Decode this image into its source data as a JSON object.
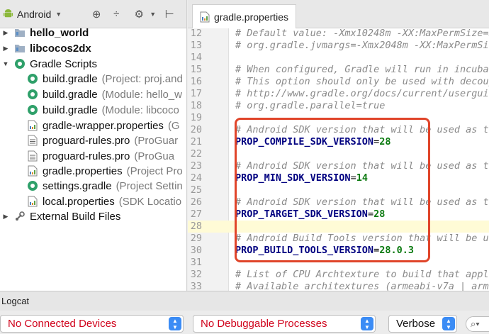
{
  "left_toolbar": {
    "view_label": "Android"
  },
  "tree": [
    {
      "label": "hello_world",
      "hint": "",
      "bold": true,
      "icon": "module-folder-icon",
      "arrow": "right"
    },
    {
      "label": "libcocos2dx",
      "hint": "",
      "bold": true,
      "icon": "module-folder-icon",
      "arrow": "right"
    },
    {
      "label": "Gradle Scripts",
      "hint": "",
      "bold": false,
      "icon": "gradle-icon",
      "arrow": "down"
    },
    {
      "label": "build.gradle",
      "hint": "(Project: proj.and",
      "bold": false,
      "icon": "gradle-icon",
      "arrow": ""
    },
    {
      "label": "build.gradle",
      "hint": "(Module: hello_w",
      "bold": false,
      "icon": "gradle-icon",
      "arrow": ""
    },
    {
      "label": "build.gradle",
      "hint": "(Module: libcoco",
      "bold": false,
      "icon": "gradle-icon",
      "arrow": ""
    },
    {
      "label": "gradle-wrapper.properties",
      "hint": "(G",
      "bold": false,
      "icon": "properties-file-icon",
      "arrow": ""
    },
    {
      "label": "proguard-rules.pro",
      "hint": "(ProGuar",
      "bold": false,
      "icon": "text-file-icon",
      "arrow": ""
    },
    {
      "label": "proguard-rules.pro",
      "hint": "(ProGua",
      "bold": false,
      "icon": "text-file-icon",
      "arrow": ""
    },
    {
      "label": "gradle.properties",
      "hint": "(Project Pro",
      "bold": false,
      "icon": "properties-file-icon",
      "arrow": ""
    },
    {
      "label": "settings.gradle",
      "hint": "(Project Settin",
      "bold": false,
      "icon": "gradle-icon",
      "arrow": ""
    },
    {
      "label": "local.properties",
      "hint": "(SDK Locatio",
      "bold": false,
      "icon": "properties-file-icon",
      "arrow": ""
    },
    {
      "label": "External Build Files",
      "hint": "",
      "bold": false,
      "icon": "external-build-icon",
      "arrow": "right"
    }
  ],
  "editor": {
    "tab_label": "gradle.properties",
    "lines": [
      {
        "n": "12",
        "parts": [
          {
            "t": "# Default value: -Xmx10248m -XX:MaxPermSize=2",
            "c": "comment"
          }
        ]
      },
      {
        "n": "13",
        "parts": [
          {
            "t": "# org.gradle.jvmargs=-Xmx2048m -XX:MaxPermSiz",
            "c": "comment"
          }
        ]
      },
      {
        "n": "14",
        "parts": []
      },
      {
        "n": "15",
        "parts": [
          {
            "t": "# When configured, Gradle will run in incubat",
            "c": "comment"
          }
        ]
      },
      {
        "n": "16",
        "parts": [
          {
            "t": "# This option should only be used with decoup",
            "c": "comment"
          }
        ]
      },
      {
        "n": "17",
        "parts": [
          {
            "t": "# http://www.gradle.org/docs/current/userguid",
            "c": "comment"
          }
        ]
      },
      {
        "n": "18",
        "parts": [
          {
            "t": "# org.gradle.parallel=true",
            "c": "comment"
          }
        ]
      },
      {
        "n": "19",
        "parts": []
      },
      {
        "n": "20",
        "parts": [
          {
            "t": "# Android SDK version that will be used as th",
            "c": "comment"
          }
        ]
      },
      {
        "n": "21",
        "parts": [
          {
            "t": "PROP_COMPILE_SDK_VERSION",
            "c": "key"
          },
          {
            "t": "=",
            "c": "eq"
          },
          {
            "t": "28",
            "c": "val"
          }
        ]
      },
      {
        "n": "22",
        "parts": []
      },
      {
        "n": "23",
        "parts": [
          {
            "t": "# Android SDK version that will be used as th",
            "c": "comment"
          }
        ]
      },
      {
        "n": "24",
        "parts": [
          {
            "t": "PROP_MIN_SDK_VERSION",
            "c": "key"
          },
          {
            "t": "=",
            "c": "eq"
          },
          {
            "t": "14",
            "c": "val"
          }
        ]
      },
      {
        "n": "25",
        "parts": []
      },
      {
        "n": "26",
        "parts": [
          {
            "t": "# Android SDK version that will be used as th",
            "c": "comment"
          }
        ]
      },
      {
        "n": "27",
        "parts": [
          {
            "t": "PROP_TARGET_SDK_VERSION",
            "c": "key"
          },
          {
            "t": "=",
            "c": "eq"
          },
          {
            "t": "28",
            "c": "val"
          }
        ]
      },
      {
        "n": "28",
        "parts": [],
        "current": true
      },
      {
        "n": "29",
        "parts": [
          {
            "t": "# Android Build Tools version that will be us",
            "c": "comment"
          }
        ]
      },
      {
        "n": "30",
        "parts": [
          {
            "t": "PROP_BUILD_TOOLS_VERSION",
            "c": "key"
          },
          {
            "t": "=",
            "c": "eq"
          },
          {
            "t": "28.0.3",
            "c": "val"
          }
        ]
      },
      {
        "n": "31",
        "parts": []
      },
      {
        "n": "32",
        "parts": [
          {
            "t": "# List of CPU Archtexture to build that appli",
            "c": "comment"
          }
        ]
      },
      {
        "n": "33",
        "parts": [
          {
            "t": "# Available architextures (armeabi-v7a | arm6",
            "c": "comment"
          }
        ]
      }
    ]
  },
  "logcat": {
    "title": "Logcat",
    "device_select": "No Connected Devices",
    "process_select": "No Debuggable Processes",
    "level_select": "Verbose",
    "search_icon": "search-icon"
  },
  "colors": {
    "highlight_box": "#e0452a",
    "error_text": "#d0021b",
    "stepper_blue": "#3b8cf5"
  }
}
